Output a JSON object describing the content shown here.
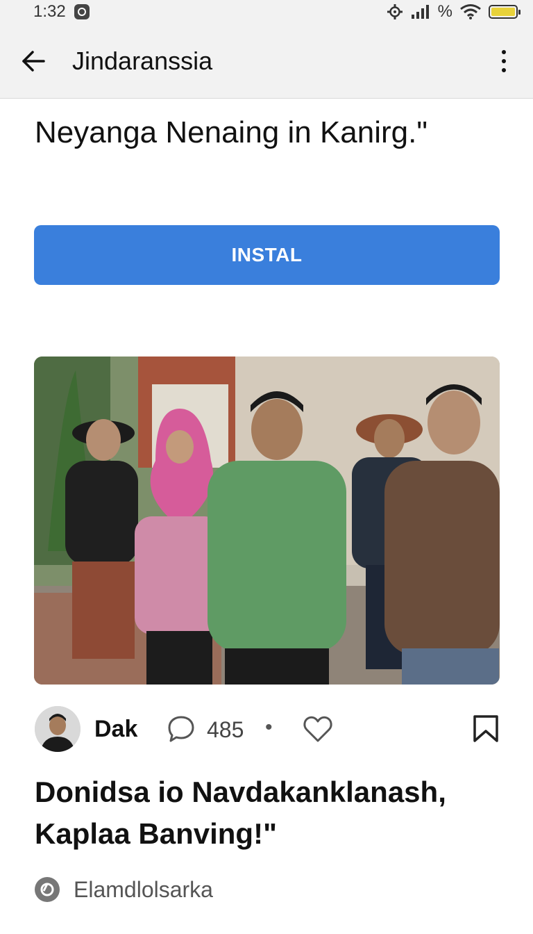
{
  "status_bar": {
    "time": "1:32",
    "signal_text": "%",
    "icons": [
      "notification-icon",
      "gear-icon",
      "signal-icon",
      "wifi-icon",
      "battery-icon"
    ]
  },
  "app_bar": {
    "title": "Jindaranssia",
    "back_icon": "arrow-left-icon",
    "menu_icon": "more-vert-icon"
  },
  "promo": {
    "text": "Neyanga Nenaing in Kanirg.\"",
    "install_label": "INSTAL",
    "install_color": "#3a7fdc"
  },
  "photo": {
    "description_icon": "group-photo"
  },
  "meta": {
    "author": "Dak",
    "comment_count": "485",
    "separator": "•",
    "icons": [
      "avatar",
      "comment-icon",
      "heart-icon",
      "bookmark-icon"
    ]
  },
  "headline": "Donidsa io Navdakanklanash, Kaplaa Banving!\"",
  "source": {
    "name": "Elamdlolsarka",
    "icon": "source-logo-icon"
  }
}
